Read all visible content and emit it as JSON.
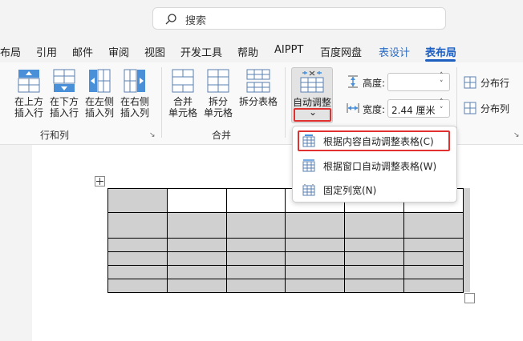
{
  "search": {
    "placeholder": "搜索"
  },
  "tabs": [
    {
      "label": "布局"
    },
    {
      "label": "引用"
    },
    {
      "label": "邮件"
    },
    {
      "label": "审阅"
    },
    {
      "label": "视图"
    },
    {
      "label": "开发工具"
    },
    {
      "label": "帮助"
    },
    {
      "label": "AIPPT"
    },
    {
      "label": "百度网盘"
    },
    {
      "label": "表设计"
    },
    {
      "label": "表布局"
    }
  ],
  "ribbon": {
    "rows_cols": {
      "insert_above": [
        "在上方",
        "插入行"
      ],
      "insert_below": [
        "在下方",
        "插入行"
      ],
      "insert_left": [
        "在左侧",
        "插入列"
      ],
      "insert_right": [
        "在右侧",
        "插入列"
      ],
      "group_label": "行和列"
    },
    "merge": {
      "merge_cells": [
        "合并",
        "单元格"
      ],
      "split_cells": [
        "拆分",
        "单元格"
      ],
      "split_table": "拆分表格",
      "group_label": "合并"
    },
    "autofit": {
      "label": "自动调整",
      "chevron": "⌄"
    },
    "size": {
      "height_label": "高度:",
      "height_value": "",
      "width_label": "宽度:",
      "width_value": "2.44 厘米"
    },
    "distribute": {
      "rows": "分布行",
      "cols": "分布列"
    }
  },
  "autofit_menu": {
    "items": [
      {
        "label": "根据内容自动调整表格(C)",
        "highlighted": true
      },
      {
        "label": "根据窗口自动调整表格(W)",
        "highlighted": false
      },
      {
        "label": "固定列宽(N)",
        "highlighted": false
      }
    ]
  },
  "colors": {
    "accent": "#1e5fc2",
    "highlight_border": "#e03030",
    "cell_fill": "#d0d0d0"
  }
}
